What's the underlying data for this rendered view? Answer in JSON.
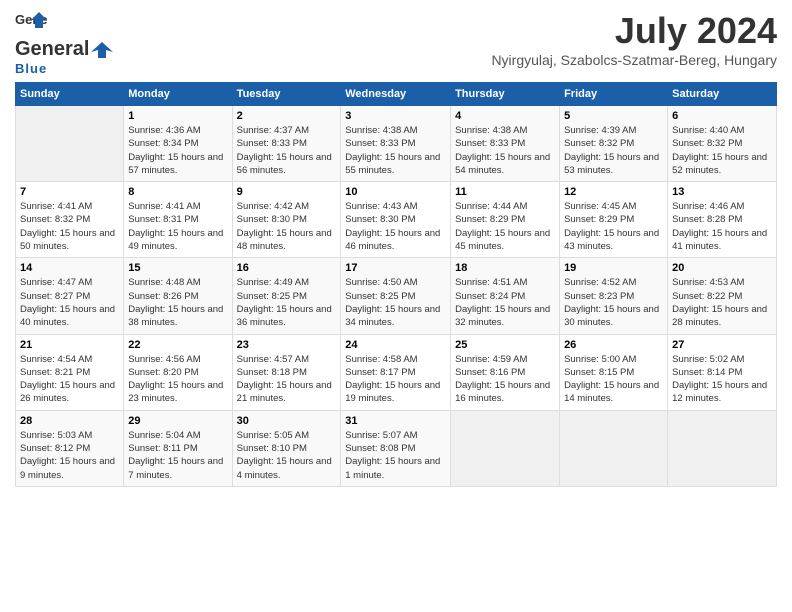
{
  "header": {
    "logo_line1": "General",
    "logo_line2": "Blue",
    "title": "July 2024",
    "location": "Nyirgyulaj, Szabolcs-Szatmar-Bereg, Hungary"
  },
  "days_of_week": [
    "Sunday",
    "Monday",
    "Tuesday",
    "Wednesday",
    "Thursday",
    "Friday",
    "Saturday"
  ],
  "weeks": [
    [
      {
        "day": "",
        "sunrise": "",
        "sunset": "",
        "daylight": "",
        "empty": true
      },
      {
        "day": "1",
        "sunrise": "Sunrise: 4:36 AM",
        "sunset": "Sunset: 8:34 PM",
        "daylight": "Daylight: 15 hours and 57 minutes."
      },
      {
        "day": "2",
        "sunrise": "Sunrise: 4:37 AM",
        "sunset": "Sunset: 8:33 PM",
        "daylight": "Daylight: 15 hours and 56 minutes."
      },
      {
        "day": "3",
        "sunrise": "Sunrise: 4:38 AM",
        "sunset": "Sunset: 8:33 PM",
        "daylight": "Daylight: 15 hours and 55 minutes."
      },
      {
        "day": "4",
        "sunrise": "Sunrise: 4:38 AM",
        "sunset": "Sunset: 8:33 PM",
        "daylight": "Daylight: 15 hours and 54 minutes."
      },
      {
        "day": "5",
        "sunrise": "Sunrise: 4:39 AM",
        "sunset": "Sunset: 8:32 PM",
        "daylight": "Daylight: 15 hours and 53 minutes."
      },
      {
        "day": "6",
        "sunrise": "Sunrise: 4:40 AM",
        "sunset": "Sunset: 8:32 PM",
        "daylight": "Daylight: 15 hours and 52 minutes."
      }
    ],
    [
      {
        "day": "7",
        "sunrise": "Sunrise: 4:41 AM",
        "sunset": "Sunset: 8:32 PM",
        "daylight": "Daylight: 15 hours and 50 minutes."
      },
      {
        "day": "8",
        "sunrise": "Sunrise: 4:41 AM",
        "sunset": "Sunset: 8:31 PM",
        "daylight": "Daylight: 15 hours and 49 minutes."
      },
      {
        "day": "9",
        "sunrise": "Sunrise: 4:42 AM",
        "sunset": "Sunset: 8:30 PM",
        "daylight": "Daylight: 15 hours and 48 minutes."
      },
      {
        "day": "10",
        "sunrise": "Sunrise: 4:43 AM",
        "sunset": "Sunset: 8:30 PM",
        "daylight": "Daylight: 15 hours and 46 minutes."
      },
      {
        "day": "11",
        "sunrise": "Sunrise: 4:44 AM",
        "sunset": "Sunset: 8:29 PM",
        "daylight": "Daylight: 15 hours and 45 minutes."
      },
      {
        "day": "12",
        "sunrise": "Sunrise: 4:45 AM",
        "sunset": "Sunset: 8:29 PM",
        "daylight": "Daylight: 15 hours and 43 minutes."
      },
      {
        "day": "13",
        "sunrise": "Sunrise: 4:46 AM",
        "sunset": "Sunset: 8:28 PM",
        "daylight": "Daylight: 15 hours and 41 minutes."
      }
    ],
    [
      {
        "day": "14",
        "sunrise": "Sunrise: 4:47 AM",
        "sunset": "Sunset: 8:27 PM",
        "daylight": "Daylight: 15 hours and 40 minutes."
      },
      {
        "day": "15",
        "sunrise": "Sunrise: 4:48 AM",
        "sunset": "Sunset: 8:26 PM",
        "daylight": "Daylight: 15 hours and 38 minutes."
      },
      {
        "day": "16",
        "sunrise": "Sunrise: 4:49 AM",
        "sunset": "Sunset: 8:25 PM",
        "daylight": "Daylight: 15 hours and 36 minutes."
      },
      {
        "day": "17",
        "sunrise": "Sunrise: 4:50 AM",
        "sunset": "Sunset: 8:25 PM",
        "daylight": "Daylight: 15 hours and 34 minutes."
      },
      {
        "day": "18",
        "sunrise": "Sunrise: 4:51 AM",
        "sunset": "Sunset: 8:24 PM",
        "daylight": "Daylight: 15 hours and 32 minutes."
      },
      {
        "day": "19",
        "sunrise": "Sunrise: 4:52 AM",
        "sunset": "Sunset: 8:23 PM",
        "daylight": "Daylight: 15 hours and 30 minutes."
      },
      {
        "day": "20",
        "sunrise": "Sunrise: 4:53 AM",
        "sunset": "Sunset: 8:22 PM",
        "daylight": "Daylight: 15 hours and 28 minutes."
      }
    ],
    [
      {
        "day": "21",
        "sunrise": "Sunrise: 4:54 AM",
        "sunset": "Sunset: 8:21 PM",
        "daylight": "Daylight: 15 hours and 26 minutes."
      },
      {
        "day": "22",
        "sunrise": "Sunrise: 4:56 AM",
        "sunset": "Sunset: 8:20 PM",
        "daylight": "Daylight: 15 hours and 23 minutes."
      },
      {
        "day": "23",
        "sunrise": "Sunrise: 4:57 AM",
        "sunset": "Sunset: 8:18 PM",
        "daylight": "Daylight: 15 hours and 21 minutes."
      },
      {
        "day": "24",
        "sunrise": "Sunrise: 4:58 AM",
        "sunset": "Sunset: 8:17 PM",
        "daylight": "Daylight: 15 hours and 19 minutes."
      },
      {
        "day": "25",
        "sunrise": "Sunrise: 4:59 AM",
        "sunset": "Sunset: 8:16 PM",
        "daylight": "Daylight: 15 hours and 16 minutes."
      },
      {
        "day": "26",
        "sunrise": "Sunrise: 5:00 AM",
        "sunset": "Sunset: 8:15 PM",
        "daylight": "Daylight: 15 hours and 14 minutes."
      },
      {
        "day": "27",
        "sunrise": "Sunrise: 5:02 AM",
        "sunset": "Sunset: 8:14 PM",
        "daylight": "Daylight: 15 hours and 12 minutes."
      }
    ],
    [
      {
        "day": "28",
        "sunrise": "Sunrise: 5:03 AM",
        "sunset": "Sunset: 8:12 PM",
        "daylight": "Daylight: 15 hours and 9 minutes."
      },
      {
        "day": "29",
        "sunrise": "Sunrise: 5:04 AM",
        "sunset": "Sunset: 8:11 PM",
        "daylight": "Daylight: 15 hours and 7 minutes."
      },
      {
        "day": "30",
        "sunrise": "Sunrise: 5:05 AM",
        "sunset": "Sunset: 8:10 PM",
        "daylight": "Daylight: 15 hours and 4 minutes."
      },
      {
        "day": "31",
        "sunrise": "Sunrise: 5:07 AM",
        "sunset": "Sunset: 8:08 PM",
        "daylight": "Daylight: 15 hours and 1 minute."
      },
      {
        "day": "",
        "sunrise": "",
        "sunset": "",
        "daylight": "",
        "empty": true
      },
      {
        "day": "",
        "sunrise": "",
        "sunset": "",
        "daylight": "",
        "empty": true
      },
      {
        "day": "",
        "sunrise": "",
        "sunset": "",
        "daylight": "",
        "empty": true
      }
    ]
  ]
}
